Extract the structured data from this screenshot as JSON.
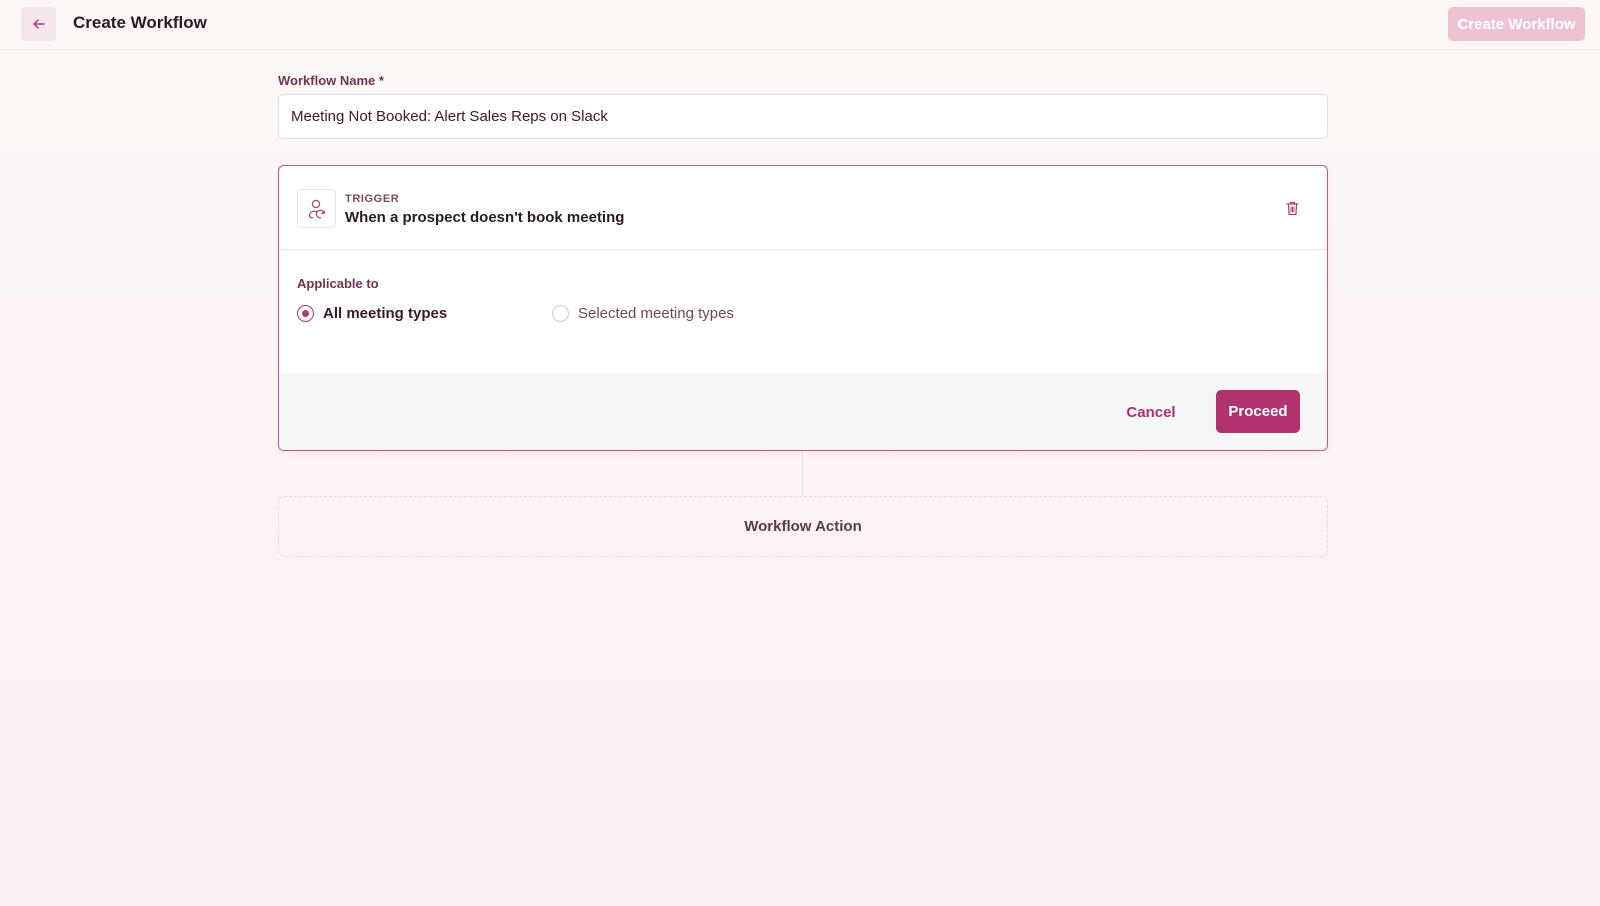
{
  "header": {
    "title": "Create Workflow",
    "create_button_label": "Create Workflow",
    "back_icon": "arrow-left-icon"
  },
  "form": {
    "name_label": "Workflow Name *",
    "name_value": "Meeting Not Booked: Alert Sales Reps on Slack"
  },
  "trigger": {
    "kicker": "TRIGGER",
    "title": "When a prospect doesn't book meeting",
    "icon": "user-sync-icon",
    "delete_icon": "trash-icon",
    "applicable_label": "Applicable to",
    "options": [
      {
        "label": "All meeting types",
        "selected": true
      },
      {
        "label": "Selected meeting types",
        "selected": false
      }
    ],
    "cancel_label": "Cancel",
    "proceed_label": "Proceed"
  },
  "action": {
    "label": "Workflow Action"
  },
  "colors": {
    "accent": "#b0336e",
    "accent_light": "#edc3d3",
    "border_accent": "#c4588a"
  }
}
